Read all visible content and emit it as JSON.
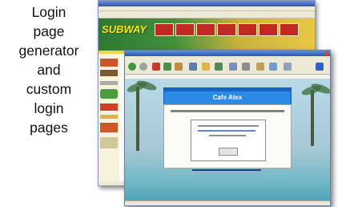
{
  "caption": {
    "lines": [
      "Login",
      "page",
      "generator",
      "and",
      "custom",
      "login",
      "pages"
    ]
  },
  "back_window": {
    "logo": "SUBWAY"
  },
  "front_window": {
    "header_title": "Cafe Atex"
  }
}
